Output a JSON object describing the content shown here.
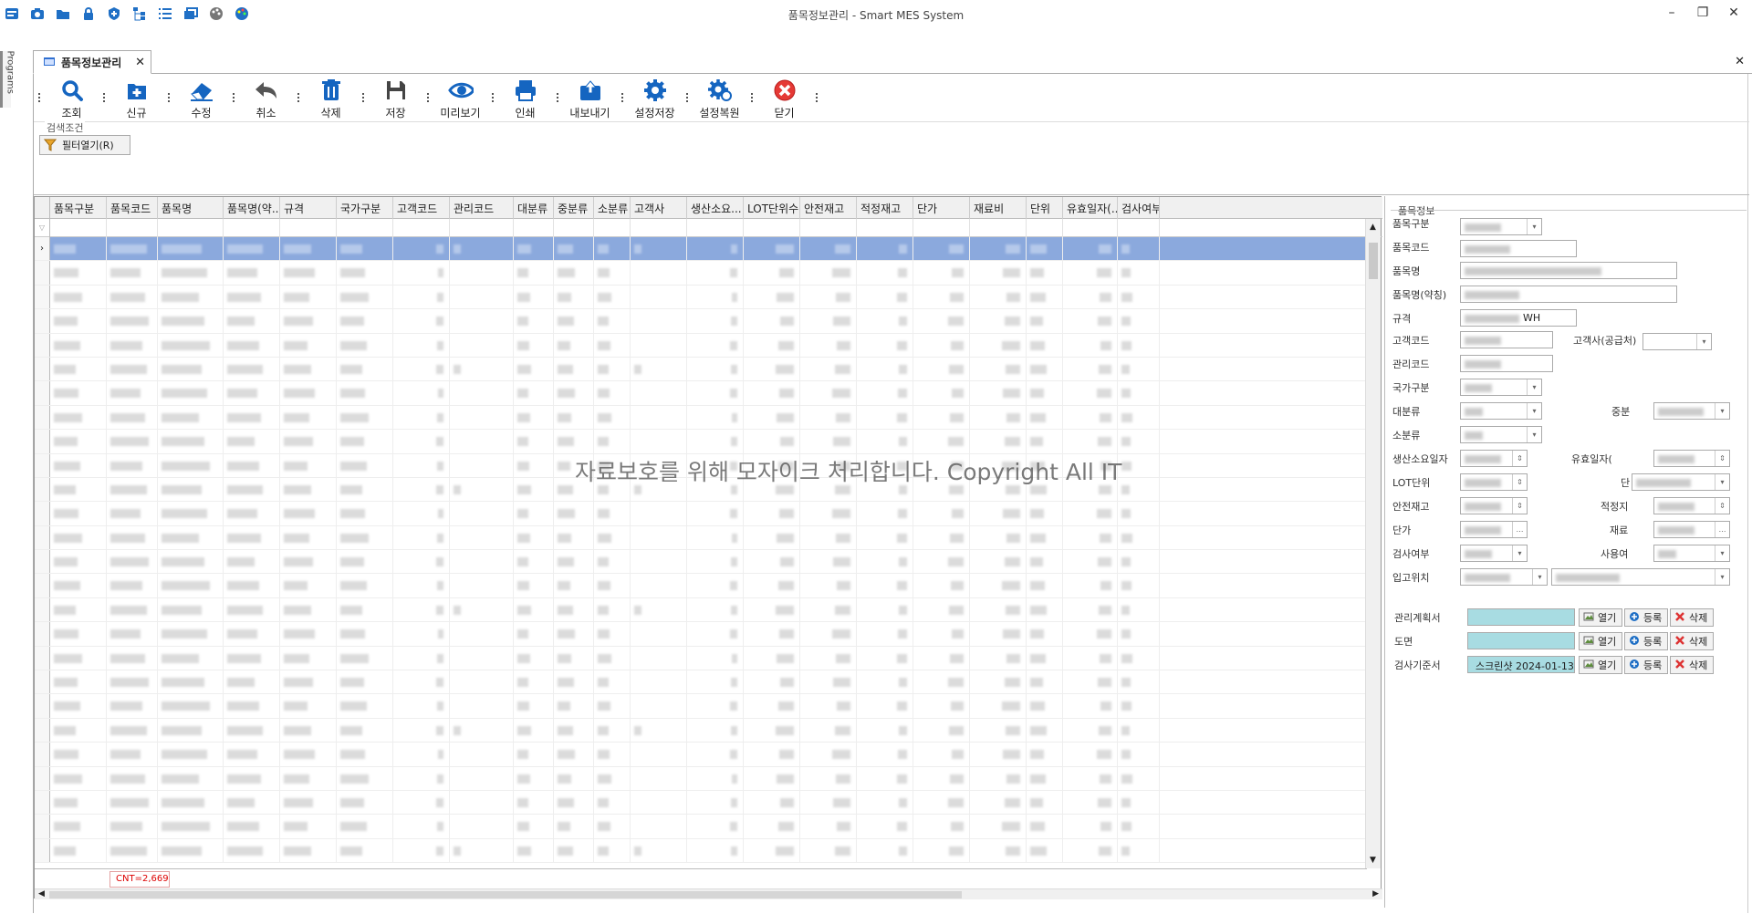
{
  "app": {
    "title": "품목정보관리 - Smart MES System",
    "side_tab": "Programs",
    "doc_tab": "품목정보관리",
    "window_controls": [
      "minimize",
      "restore",
      "close"
    ],
    "quick_icons": [
      "camera-icon",
      "folder-icon",
      "lock-icon",
      "shield-icon",
      "tree-icon",
      "list-icon",
      "window-icon",
      "palette-icon",
      "palette-color-icon"
    ]
  },
  "toolbar": {
    "buttons": [
      {
        "label": "조회",
        "icon": "search-icon"
      },
      {
        "label": "신규",
        "icon": "add-icon"
      },
      {
        "label": "수정",
        "icon": "eraser-icon"
      },
      {
        "label": "취소",
        "icon": "undo-icon"
      },
      {
        "label": "삭제",
        "icon": "trash-icon"
      },
      {
        "label": "저장",
        "icon": "save-icon"
      },
      {
        "label": "미리보기",
        "icon": "eye-icon"
      },
      {
        "label": "인쇄",
        "icon": "print-icon"
      },
      {
        "label": "내보내기",
        "icon": "export-icon"
      },
      {
        "label": "설정저장",
        "icon": "gear-icon"
      },
      {
        "label": "설정복원",
        "icon": "gear-restore-icon"
      },
      {
        "label": "닫기",
        "icon": "close-icon"
      }
    ]
  },
  "search": {
    "legend": "검색조건",
    "filter_button": "필터열기(R)"
  },
  "grid": {
    "columns": [
      "품목구분",
      "품목코드",
      "품목명",
      "품목명(약...",
      "규격",
      "국가구분",
      "고객코드",
      "관리코드",
      "대분류",
      "중분류",
      "소분류",
      "고객사",
      "생산소요...",
      "LOT단위수...",
      "안전재고",
      "적정재고",
      "단가",
      "재료비",
      "단위",
      "유효일자(...",
      "검사여부"
    ],
    "row_count_visible": 26,
    "selected_row": 0,
    "count_label": "CNT=2,669"
  },
  "watermark": "자료보호를 위해 모자이크 처리합니다. Copyright All IT",
  "detail": {
    "legend": "품목정보",
    "labels": {
      "item_type": "품목구분",
      "item_code": "품목코드",
      "item_name": "품목명",
      "item_name_short": "품목명(약칭)",
      "spec": "규격",
      "customer_code": "고객코드",
      "customer_supplier": "고객사(공급처)",
      "manage_code": "관리코드",
      "country": "국가구분",
      "major": "대분류",
      "middle": "중분",
      "minor": "소분류",
      "lead_time": "생산소요일자",
      "expiry": "유효일자(",
      "lot_unit": "LOT단위",
      "unit": "단",
      "safety_stock": "안전재고",
      "proper_stock": "적정지",
      "price": "단가",
      "material": "재료",
      "inspection": "검사여부",
      "use": "사용여",
      "location": "입고위치",
      "plan_doc": "관리계획서",
      "drawing": "도면",
      "inspect_std": "검사기준서"
    },
    "spec_value": "WH",
    "inspect_std_file": "스크린샷 2024-01-13",
    "file_buttons": {
      "open": "열기",
      "register": "등록",
      "delete": "삭제"
    }
  }
}
